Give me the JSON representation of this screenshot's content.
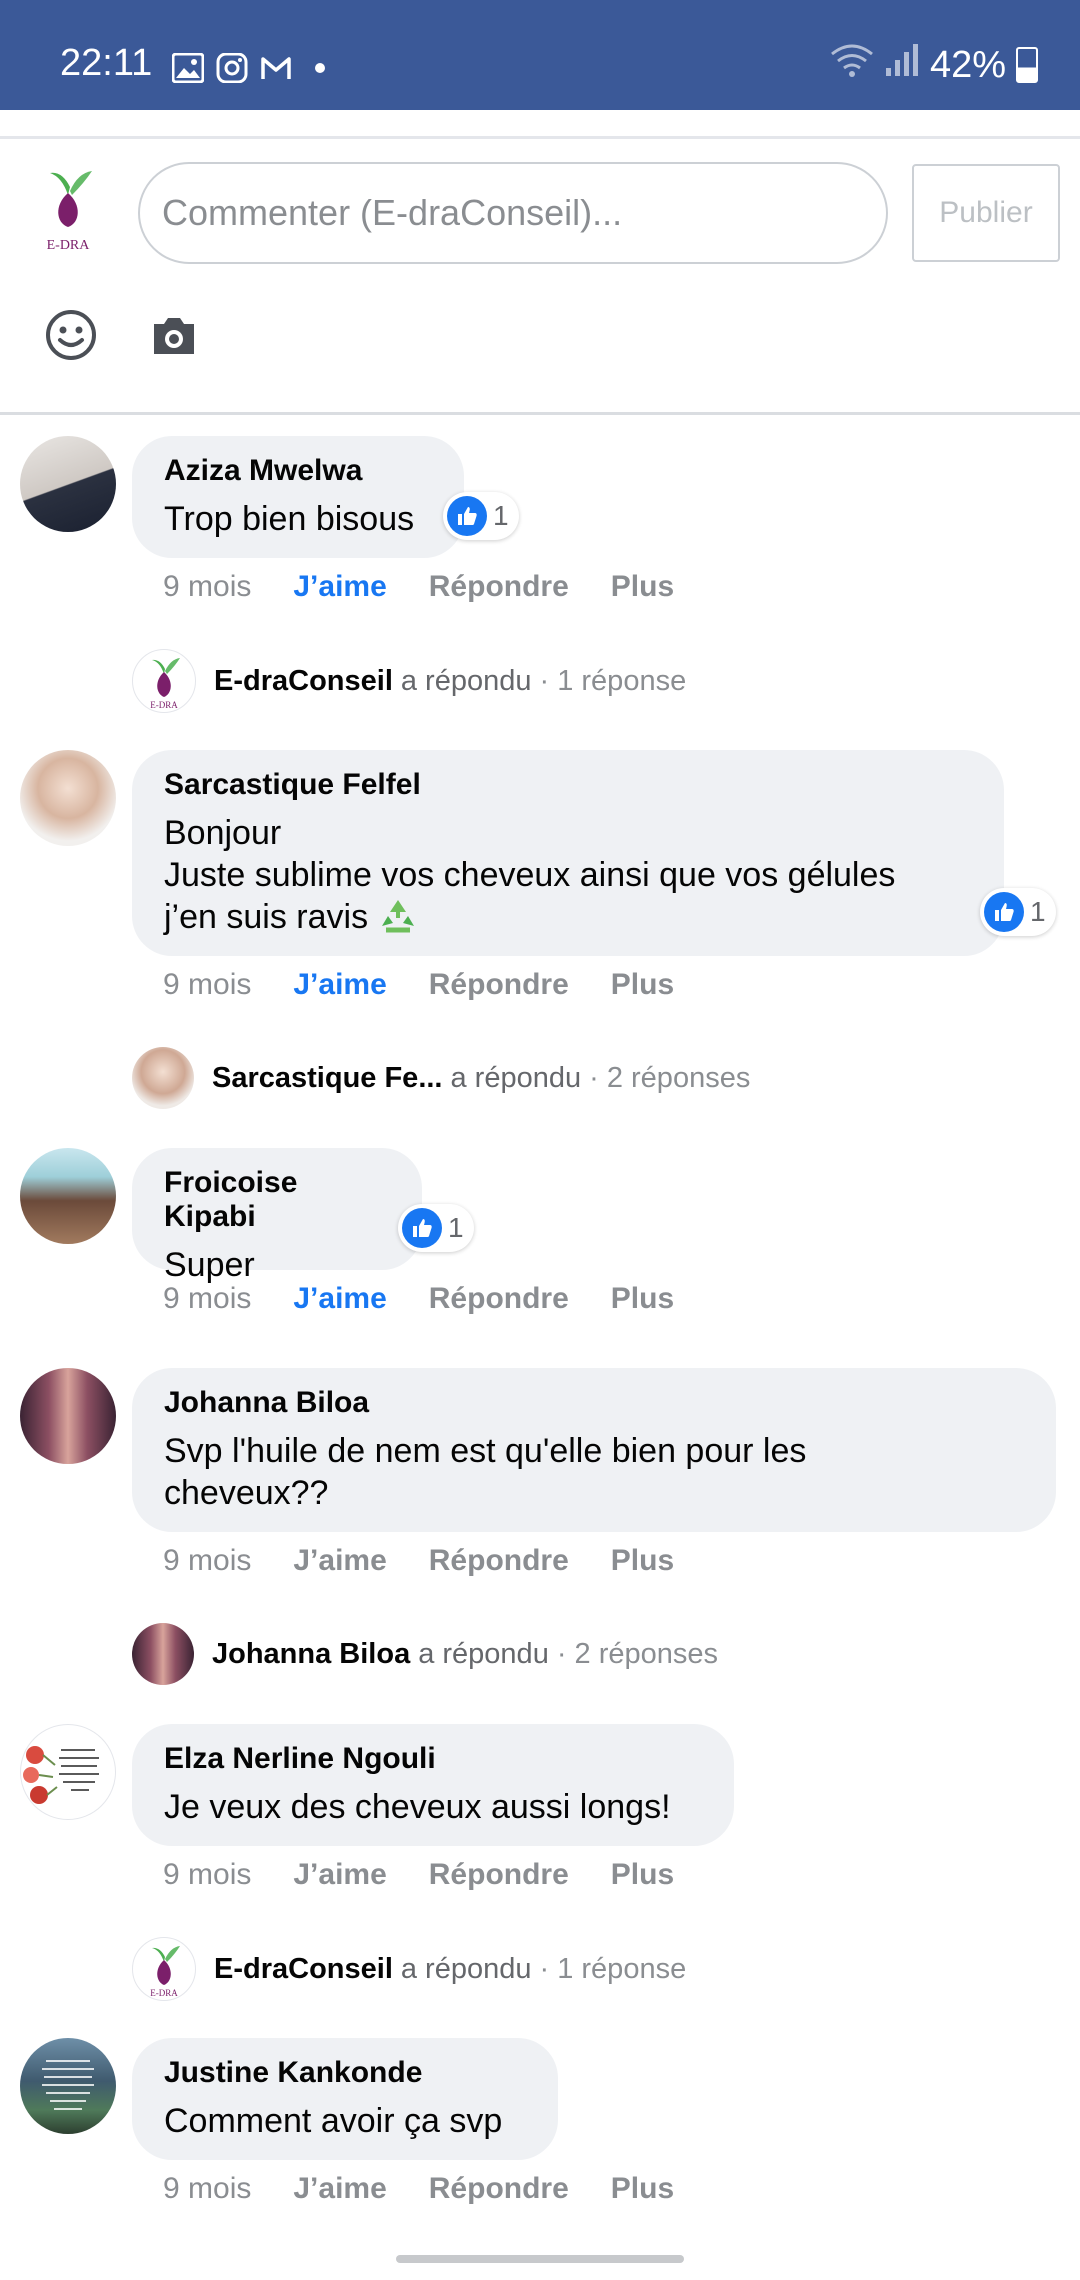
{
  "status_bar": {
    "time": "22:11",
    "notification_icons": [
      "gallery-icon",
      "instagram-icon",
      "gmail-icon",
      "dot-icon"
    ],
    "battery": "42%",
    "colors": {
      "background": "#3b5998"
    }
  },
  "composer": {
    "placeholder": "Commenter (E-draConseil)...",
    "publish_label": "Publier",
    "logo_text": "E-DRA"
  },
  "comments": [
    {
      "author": "Aziza Mwelwa",
      "text": "Trop bien bisous",
      "likes": "1",
      "age": "9 mois",
      "like_label": "J’aime",
      "reply_label": "Répondre",
      "more_label": "Plus",
      "reply_summary": {
        "name": "E-draConseil",
        "verb": "a répondu",
        "count": "· 1 réponse"
      }
    },
    {
      "author": "Sarcastique Felfel",
      "text": "Bonjour\nJuste sublime vos cheveux ainsi que vos gélules\nj’en suis ravis",
      "likes": "1",
      "age": "9 mois",
      "like_label": "J’aime",
      "reply_label": "Répondre",
      "more_label": "Plus",
      "reply_summary": {
        "name": "Sarcastique Fe...",
        "verb": "a répondu",
        "count": "· 2 réponses"
      }
    },
    {
      "author": "Froicoise Kipabi",
      "text": "Super",
      "likes": "1",
      "age": "9 mois",
      "like_label": "J’aime",
      "reply_label": "Répondre",
      "more_label": "Plus"
    },
    {
      "author": "Johanna Biloa",
      "text": "Svp l'huile de nem est qu'elle bien pour les\ncheveux??",
      "age": "9 mois",
      "like_label": "J’aime",
      "reply_label": "Répondre",
      "more_label": "Plus",
      "reply_summary": {
        "name": "Johanna Biloa",
        "verb": "a répondu",
        "count": "· 2 réponses"
      }
    },
    {
      "author": "Elza Nerline Ngouli",
      "text": "Je veux des cheveux aussi longs!",
      "age": "9 mois",
      "like_label": "J’aime",
      "reply_label": "Répondre",
      "more_label": "Plus",
      "reply_summary": {
        "name": "E-draConseil",
        "verb": "a répondu",
        "count": "· 1 réponse"
      }
    },
    {
      "author": "Justine Kankonde",
      "text": "Comment avoir ça svp",
      "age": "9 mois",
      "like_label": "J’aime",
      "reply_label": "Répondre",
      "more_label": "Plus"
    }
  ]
}
